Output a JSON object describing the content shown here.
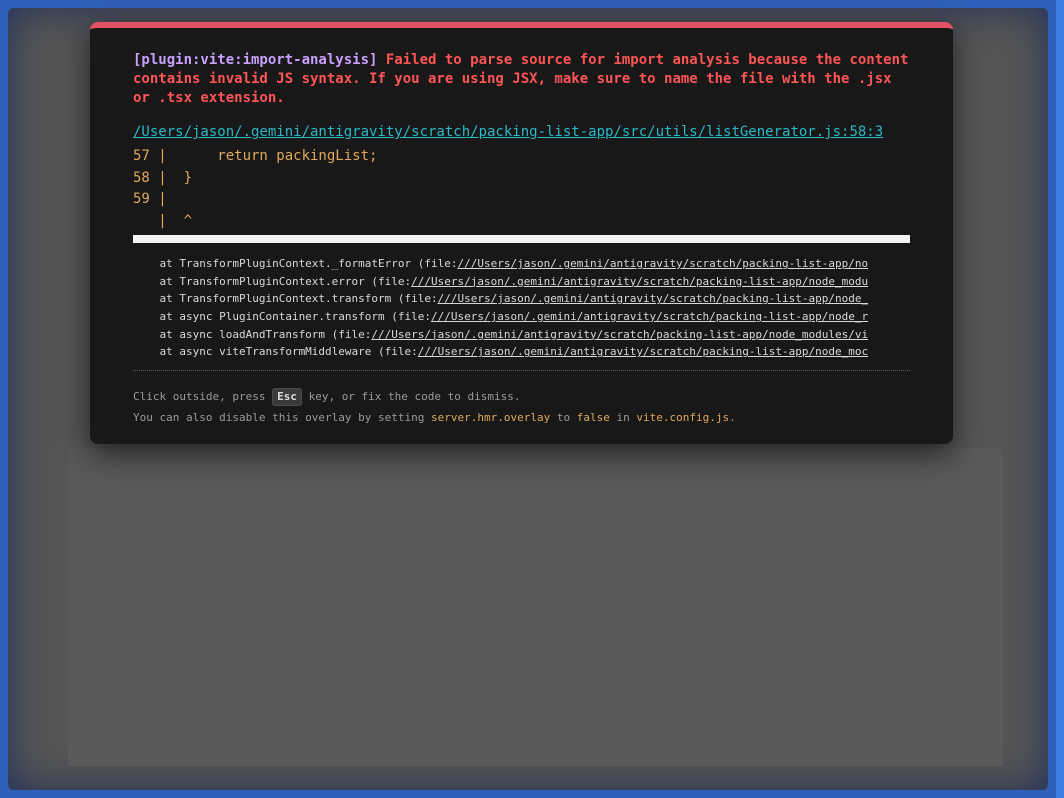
{
  "overlay": {
    "plugin_label": "[plugin:vite:import-analysis]",
    "message": "Failed to parse source for import analysis because the content contains invalid JS syntax. If you are using JSX, make sure to name the file with the .jsx or .tsx extension.",
    "file_link": "/Users/jason/.gemini/antigravity/scratch/packing-list-app/src/utils/listGenerator.js:58:3",
    "code_frame": [
      "57 |      return packingList;",
      "58 |  }",
      "59 |",
      "   |  ^"
    ],
    "stack": [
      {
        "prefix": "    at TransformPluginContext._formatError (file:",
        "url": "///Users/jason/.gemini/antigravity/scratch/packing-list-app/no"
      },
      {
        "prefix": "    at TransformPluginContext.error (file:",
        "url": "///Users/jason/.gemini/antigravity/scratch/packing-list-app/node_modu"
      },
      {
        "prefix": "    at TransformPluginContext.transform (file:",
        "url": "///Users/jason/.gemini/antigravity/scratch/packing-list-app/node_"
      },
      {
        "prefix": "    at async PluginContainer.transform (file:",
        "url": "///Users/jason/.gemini/antigravity/scratch/packing-list-app/node_r"
      },
      {
        "prefix": "    at async loadAndTransform (file:",
        "url": "///Users/jason/.gemini/antigravity/scratch/packing-list-app/node_modules/vi"
      },
      {
        "prefix": "    at async viteTransformMiddleware (file:",
        "url": "///Users/jason/.gemini/antigravity/scratch/packing-list-app/node_moc"
      }
    ],
    "tip": {
      "line1_before": "Click outside, press ",
      "key": "Esc",
      "line1_after": " key, or fix the code to dismiss.",
      "line2_before": "You can also disable this overlay by setting ",
      "setting": "server.hmr.overlay",
      "line2_mid": " to ",
      "value": "false",
      "line2_mid2": " in ",
      "config_file": "vite.config.js",
      "line2_end": "."
    }
  },
  "colors": {
    "accent_bar": "#e25165",
    "error_text": "#ff5555",
    "plugin_text": "#c9a0ff",
    "link": "#2bb8c8",
    "code_frame": "#e0a85a"
  }
}
